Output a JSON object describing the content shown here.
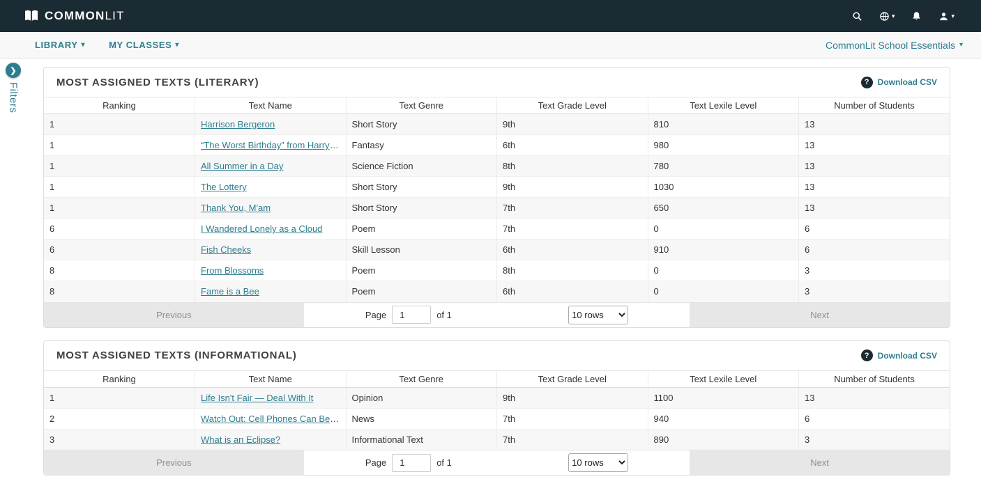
{
  "topbar": {
    "brand_common": "COMMON",
    "brand_lit": "LIT"
  },
  "nav": {
    "library_label": "LIBRARY",
    "my_classes_label": "MY CLASSES",
    "school_label": "CommonLit School Essentials"
  },
  "filters": {
    "label": "Filters"
  },
  "panels": [
    {
      "title": "MOST ASSIGNED TEXTS (LITERARY)",
      "help_icon": "?",
      "download_label": "Download CSV",
      "columns": [
        "Ranking",
        "Text Name",
        "Text Genre",
        "Text Grade Level",
        "Text Lexile Level",
        "Number of Students"
      ],
      "rows": [
        [
          "1",
          "Harrison Bergeron",
          "Short Story",
          "9th",
          "810",
          "13"
        ],
        [
          "1",
          "“The Worst Birthday” from Harry P...",
          "Fantasy",
          "6th",
          "980",
          "13"
        ],
        [
          "1",
          "All Summer in a Day",
          "Science Fiction",
          "8th",
          "780",
          "13"
        ],
        [
          "1",
          "The Lottery",
          "Short Story",
          "9th",
          "1030",
          "13"
        ],
        [
          "1",
          "Thank You, M'am",
          "Short Story",
          "7th",
          "650",
          "13"
        ],
        [
          "6",
          "I Wandered Lonely as a Cloud",
          "Poem",
          "7th",
          "0",
          "6"
        ],
        [
          "6",
          "Fish Cheeks",
          "Skill Lesson",
          "6th",
          "910",
          "6"
        ],
        [
          "8",
          "From Blossoms",
          "Poem",
          "8th",
          "0",
          "3"
        ],
        [
          "8",
          "Fame is a Bee",
          "Poem",
          "6th",
          "0",
          "3"
        ]
      ],
      "pagination": {
        "previous": "Previous",
        "page_label": "Page",
        "page_value": "1",
        "of_label": "of 1",
        "rows_option": "10 rows",
        "next": "Next"
      }
    },
    {
      "title": "MOST ASSIGNED TEXTS (INFORMATIONAL)",
      "help_icon": "?",
      "download_label": "Download CSV",
      "columns": [
        "Ranking",
        "Text Name",
        "Text Genre",
        "Text Grade Level",
        "Text Lexile Level",
        "Number of Students"
      ],
      "rows": [
        [
          "1",
          "Life Isn't Fair — Deal With It",
          "Opinion",
          "9th",
          "1100",
          "13"
        ],
        [
          "2",
          "Watch Out: Cell Phones Can Be Add...",
          "News",
          "7th",
          "940",
          "6"
        ],
        [
          "3",
          "What is an Eclipse?",
          "Informational Text",
          "7th",
          "890",
          "3"
        ]
      ],
      "pagination": {
        "previous": "Previous",
        "page_label": "Page",
        "page_value": "1",
        "of_label": "of 1",
        "rows_option": "10 rows",
        "next": "Next"
      }
    }
  ]
}
